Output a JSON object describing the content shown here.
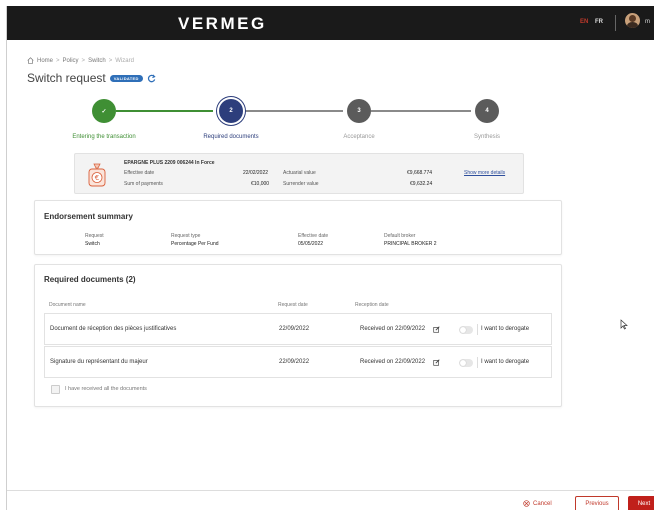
{
  "header": {
    "logo": "VERMEG",
    "lang_active": "EN",
    "lang_other": "FR",
    "user_initial": "m"
  },
  "breadcrumb": [
    "Home",
    "Policy",
    "Switch",
    "Wizard"
  ],
  "page": {
    "title": "Switch request",
    "status_badge": "VALIDATED"
  },
  "stepper": {
    "steps": [
      {
        "number": "✓",
        "label": "Entering the transaction",
        "state": "done"
      },
      {
        "number": "2",
        "label": "Required documents",
        "state": "active"
      },
      {
        "number": "3",
        "label": "Acceptance",
        "state": "todo"
      },
      {
        "number": "4",
        "label": "Synthesis",
        "state": "todo"
      }
    ]
  },
  "policy": {
    "name": "EPARGNE PLUS 2209 006244 In Force",
    "effective_date_label": "Effective date",
    "effective_date": "22/02/2022",
    "sum_payments_label": "Sum of payments",
    "sum_payments": "€10,000",
    "actuarial_label": "Actuarial value",
    "actuarial_value": "€9,668.774",
    "surrender_label": "Surrender value",
    "surrender_value": "€9,632.24",
    "show_more": "Show more details"
  },
  "endorsement": {
    "title": "Endorsement summary",
    "fields": [
      {
        "label": "Request",
        "value": "Switch"
      },
      {
        "label": "Request type",
        "value": "Percentage Per Fund"
      },
      {
        "label": "Effective date",
        "value": "05/05/2022"
      },
      {
        "label": "Default broker",
        "value": "PRINCIPAL BROKER 2"
      }
    ]
  },
  "documents": {
    "title": "Required documents (2)",
    "columns": [
      "Document name",
      "Request date",
      "Reception date"
    ],
    "rows": [
      {
        "name": "Document de réception des pièces justificatives",
        "request_date": "22/09/2022",
        "reception": "Received on 22/09/2022",
        "toggle_label": "I want to derogate"
      },
      {
        "name": "Signature du représentant du majeur",
        "request_date": "22/09/2022",
        "reception": "Received on 22/09/2022",
        "toggle_label": "I want to derogate"
      }
    ],
    "all_received_label": "I have received all the documents"
  },
  "footer": {
    "cancel": "Cancel",
    "previous": "Previous",
    "next": "Next"
  },
  "colors": {
    "accent": "#c0201b",
    "step_done": "#3f8f34",
    "step_active": "#2d3e7c",
    "badge": "#2f6fb8"
  }
}
